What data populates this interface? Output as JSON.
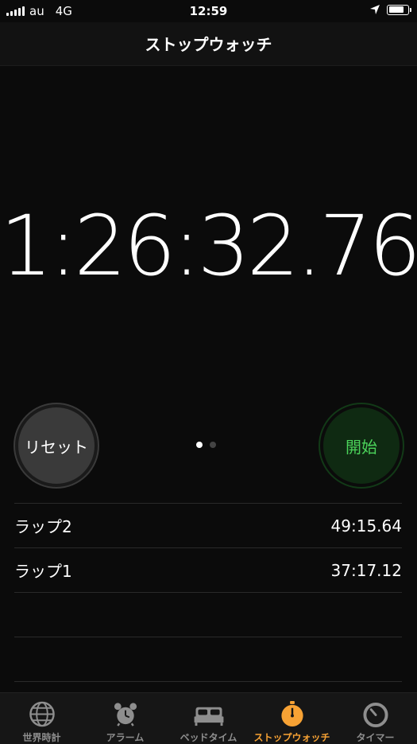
{
  "status_bar": {
    "carrier": "au",
    "network": "4G",
    "time": "12:59",
    "battery_level": 0.85
  },
  "nav": {
    "title": "ストップウォッチ"
  },
  "stopwatch": {
    "display": "1:26:32.76",
    "reset_label": "リセット",
    "start_label": "開始",
    "page_count": 2,
    "current_page": 1
  },
  "laps": [
    {
      "name": "ラップ2",
      "time": "49:15.64"
    },
    {
      "name": "ラップ1",
      "time": "37:17.12"
    }
  ],
  "tabs": [
    {
      "label": "世界時計",
      "icon": "globe-icon",
      "active": false
    },
    {
      "label": "アラーム",
      "icon": "alarm-clock-icon",
      "active": false
    },
    {
      "label": "ベッドタイム",
      "icon": "bed-icon",
      "active": false
    },
    {
      "label": "ストップウォッチ",
      "icon": "stopwatch-icon",
      "active": true
    },
    {
      "label": "タイマー",
      "icon": "timer-icon",
      "active": false
    }
  ],
  "colors": {
    "accent": "#f7a234",
    "start_green": "#4bd35a",
    "inactive_tab": "#8e8e8e"
  }
}
